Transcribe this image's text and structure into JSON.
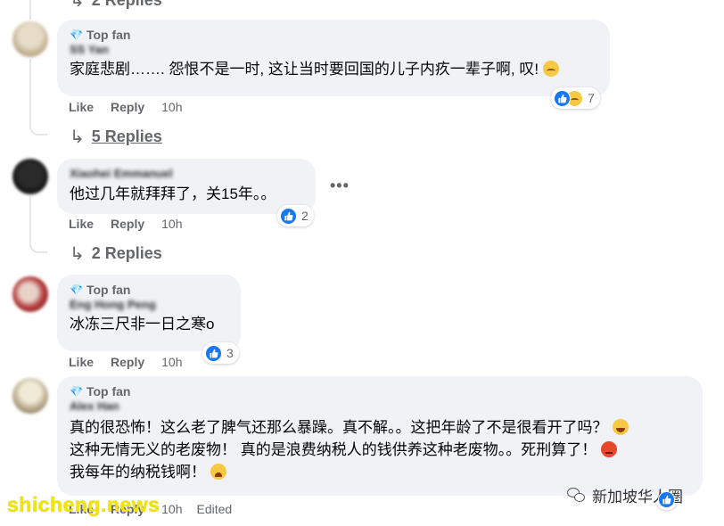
{
  "top_cut_text": "2 Replies",
  "actions_labels": {
    "like": "Like",
    "reply": "Reply"
  },
  "comments": [
    {
      "badge": "Top fan",
      "author": "SS Yan",
      "text": "家庭悲剧……. 怨恨不是一时, 这让当时要回国的儿子内疚一辈子啊, 叹!",
      "reaction_count": "7",
      "time": "10h",
      "replies": "5 Replies"
    },
    {
      "author": "Xiaohei Emmanuel",
      "text": "他过几年就拜拜了，关15年。。",
      "reaction_count": "2",
      "time": "10h",
      "replies": "2 Replies"
    },
    {
      "badge": "Top fan",
      "author": "Eng Hong Peng",
      "text": "冰冻三尺非一日之寒o",
      "reaction_count": "3",
      "time": "10h"
    },
    {
      "badge": "Top fan",
      "author": "Alex Han",
      "lines": [
        "真的很恐怖！这么老了脾气还那么暴躁。真不解。。这把年龄了不是很看开了吗？",
        "这种无情无义的老废物！ 真的是浪费纳税人的钱供养这种老废物。。死刑算了！",
        "我每年的纳税钱啊！"
      ],
      "time": "10h",
      "edited": "Edited"
    }
  ],
  "more_options": "•••",
  "watermark": "shicheng.news",
  "wechat_label": "新加坡华人圈",
  "colors": {
    "bubble": "#f0f2f5",
    "like_blue": "#1877f2",
    "muted": "#65676b",
    "watermark": "#f2e600"
  }
}
